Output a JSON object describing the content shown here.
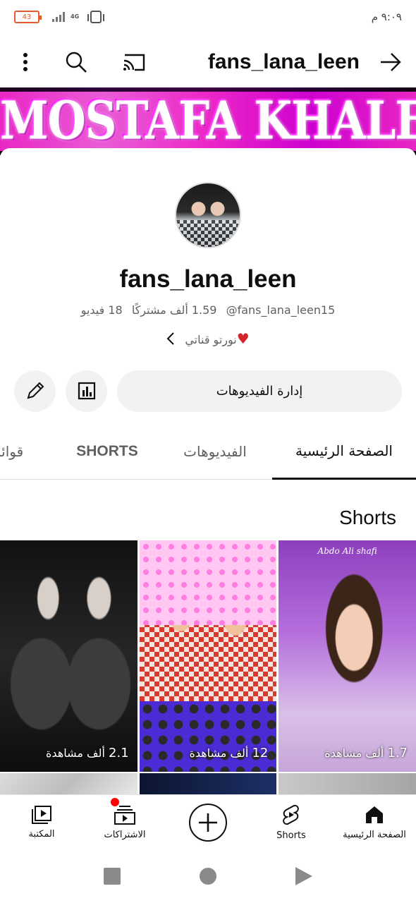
{
  "status_bar": {
    "battery": "43",
    "network": "4G",
    "time": "٩:٠٩ م"
  },
  "app_bar": {
    "title": "fans_lana_leen",
    "icons": [
      "more-vert-icon",
      "search-icon",
      "cast-icon",
      "back-arrow-icon"
    ]
  },
  "banner": {
    "text": "MOSTAFA KHALED"
  },
  "channel": {
    "name": "fans_lana_leen",
    "handle": "@fans_lana_leen15",
    "subscribers": "1.59 ألف مشتركًا",
    "videos": "18 فيديو",
    "description": "نورتو قناتي",
    "manage_videos": "إدارة الفيديوهات"
  },
  "tabs": {
    "home": "الصفحة الرئيسية",
    "videos": "الفيديوهات",
    "shorts": "SHORTS",
    "playlists": "قوائم"
  },
  "shorts_section": {
    "title": "Shorts",
    "items": [
      {
        "views_num": "1.7",
        "views_label": "ألف مشاهدة",
        "watermark": "Abdo Ali shafi"
      },
      {
        "views_num": "12",
        "views_label": "ألف مشاهدة"
      },
      {
        "views_num": "2.1",
        "views_label": "ألف مشاهدة"
      }
    ]
  },
  "bottom_nav": {
    "home": "الصفحة الرئيسية",
    "shorts": "Shorts",
    "subscriptions": "الاشتراكات",
    "library": "المكتبة"
  },
  "colors": {
    "accent_red": "#ff0000",
    "banner_pink": "#ff2bd6",
    "battery": "#e25b2a"
  }
}
